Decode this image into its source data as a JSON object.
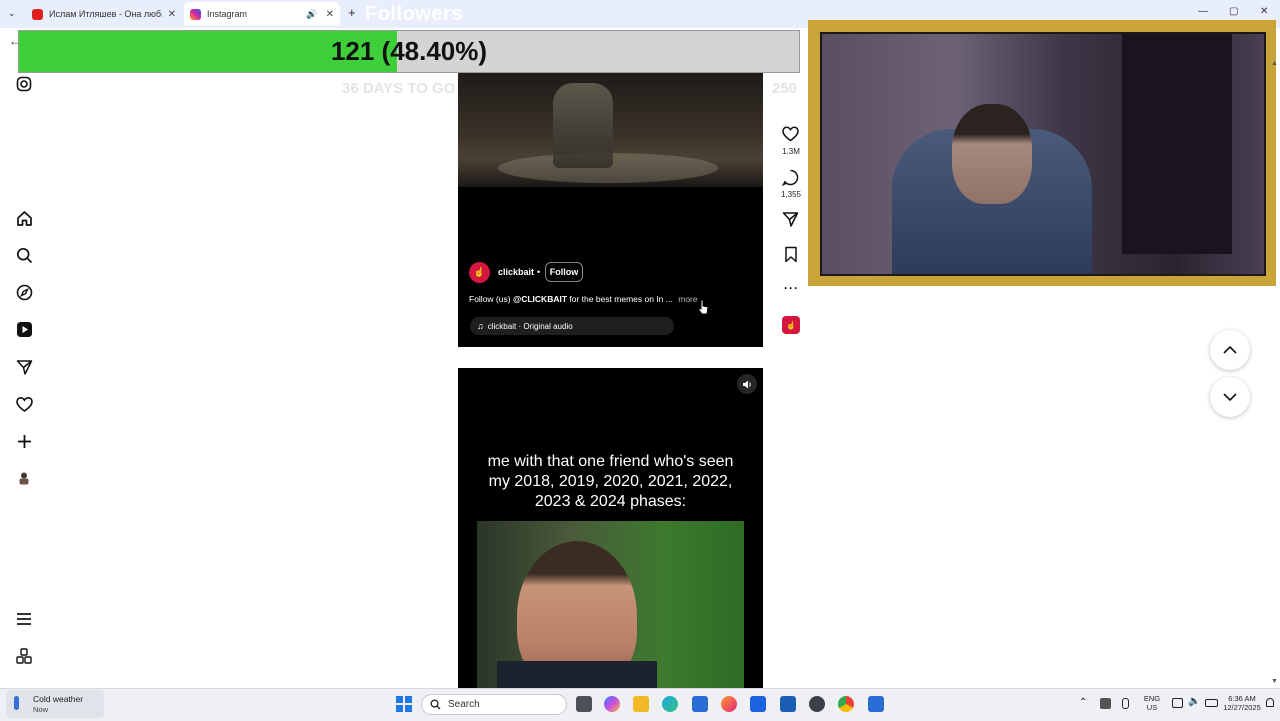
{
  "browser": {
    "tabs": [
      {
        "title": "Ислам Итляшев - Она любила",
        "favicon_color": "#e02020"
      },
      {
        "title": "Instagram",
        "favicon_color": "#d6249f"
      }
    ],
    "new_tab_glyph": "+",
    "close_glyph": "✕"
  },
  "stream_overlay": {
    "followers_label": "Followers",
    "goal_text": "121 (48.40%)",
    "goal_progress_fraction": 0.484,
    "days_left": "36 DAYS TO GO",
    "goal_max": "250",
    "fill_color": "#3fcf3a"
  },
  "instagram": {
    "nav_icons": [
      "instagram-logo-icon",
      "home-icon",
      "search-icon",
      "explore-icon",
      "reels-icon",
      "messages-icon",
      "notifications-icon",
      "create-icon",
      "profile-icon",
      "more-menu-icon",
      "meta-apps-icon"
    ],
    "reel1": {
      "username": "clickbait",
      "separator": "•",
      "follow_label": "Follow",
      "caption_prefix": "Follow (us) ",
      "caption_handle": "@CLICKBAIT",
      "caption_rest": " for the best memes on In ...",
      "more_label": "more",
      "audio_label": "clickbait · Original audio",
      "likes": "1.3M",
      "comments": "1,355"
    },
    "reel2": {
      "meme_text": "me with that one friend who's seen my 2018, 2019, 2020, 2021, 2022, 2023 & 2024 phases:"
    }
  },
  "taskbar": {
    "weather_title": "Cold weather",
    "weather_sub": "Now",
    "search_placeholder": "Search",
    "lang_top": "ENG",
    "lang_bottom": "US",
    "time": "6:36 AM",
    "date": "12/27/2025"
  }
}
